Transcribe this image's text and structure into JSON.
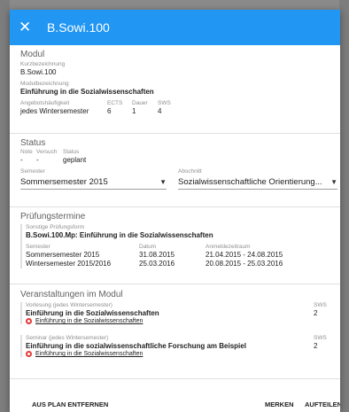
{
  "dialog": {
    "title": "B.Sowi.100",
    "close_icon": "close-icon"
  },
  "modul": {
    "section_title": "Modul",
    "kurz_label": "Kurzbezeichnung",
    "kurz_value": "B.Sowi.100",
    "bez_label": "Modulbezeichnung",
    "bez_value": "Einführung in die Sozialwissenschaften",
    "haeuf_label": "Angebotshäufigkeit",
    "haeuf_value": "jedes Wintersemester",
    "ects_label": "ECTS",
    "ects_value": "6",
    "dauer_label": "Dauer",
    "dauer_value": "1",
    "sws_label": "SWS",
    "sws_value": "4"
  },
  "status": {
    "section_title": "Status",
    "note_label": "Note",
    "note_value": "-",
    "versuch_label": "Versuch",
    "versuch_value": "-",
    "status_label": "Status",
    "status_value": "geplant",
    "semester_label": "Semester",
    "semester_value": "Sommersemester 2015",
    "abschnitt_label": "Abschnitt",
    "abschnitt_value": "Sozialwissenschaftliche Orientierung..."
  },
  "pruefung": {
    "section_title": "Prüfungstermine",
    "form_label": "Sonstige Prüfungsform",
    "form_value": "B.Sowi.100.Mp: Einführung in die Sozialwissenschaften",
    "col_semester": "Semester",
    "col_datum": "Datum",
    "col_anmeld": "Anmeldezeitraum",
    "rows": [
      {
        "semester": "Sommersemester 2015",
        "datum": "31.08.2015",
        "anmeld": "21.04.2015 - 24.08.2015"
      },
      {
        "semester": "Wintersemester 2015/2016",
        "datum": "25.03.2016",
        "anmeld": "20.08.2015 - 25.03.2016"
      }
    ]
  },
  "veranst": {
    "section_title": "Veranstaltungen im Modul",
    "items": [
      {
        "type": "Vorlesung (jedes Wintersemester)",
        "title": "Einführung in die Sozialwissenschaften",
        "sws_label": "SWS",
        "sws": "2",
        "link": "Einführung in die Sozialwissenschaften"
      },
      {
        "type": "Seminar (jedes Wintersemester)",
        "title": "Einführung in die sozialwissenschaftliche Forschung am Beispiel",
        "sws_label": "SWS",
        "sws": "2",
        "link": "Einführung in die Sozialwissenschaften"
      }
    ]
  },
  "actions": {
    "remove": "AUS PLAN ENTFERNEN",
    "merken": "MERKEN",
    "aufteilen": "AUFTEILEN"
  },
  "colors": {
    "header": "#2196f3",
    "link_icon": "#e53935"
  }
}
